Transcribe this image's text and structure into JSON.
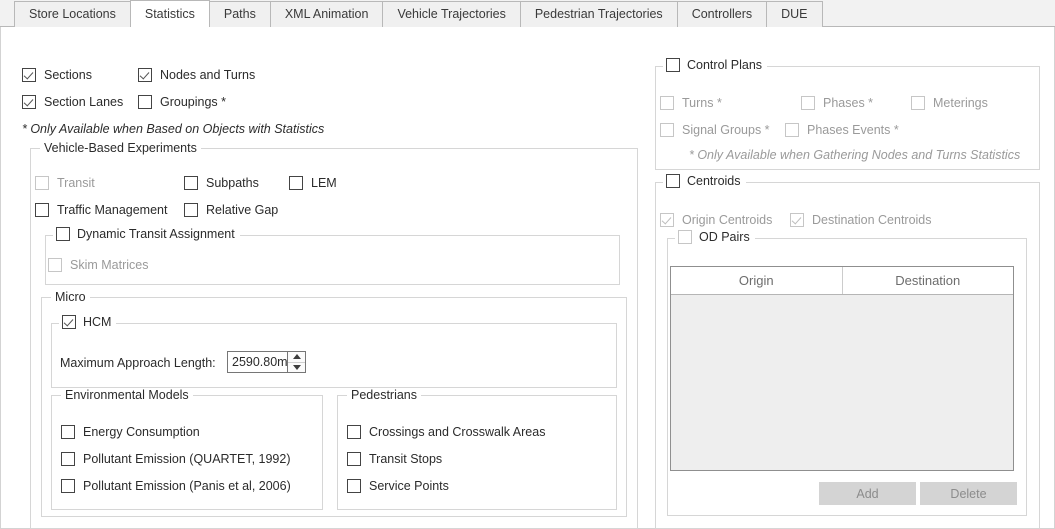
{
  "tabs": [
    {
      "label": "Store Locations",
      "active": false
    },
    {
      "label": "Statistics",
      "active": true
    },
    {
      "label": "Paths",
      "active": false
    },
    {
      "label": "XML Animation",
      "active": false
    },
    {
      "label": "Vehicle Trajectories",
      "active": false
    },
    {
      "label": "Pedestrian Trajectories",
      "active": false
    },
    {
      "label": "Controllers",
      "active": false
    },
    {
      "label": "DUE",
      "active": false
    }
  ],
  "left": {
    "top_checkboxes": {
      "sections": "Sections",
      "nodes_and_turns": "Nodes and Turns",
      "section_lanes": "Section Lanes",
      "groupings": "Groupings *"
    },
    "footnote": "* Only Available when Based on Objects with Statistics",
    "vehicle_based_experiments": {
      "legend": "Vehicle-Based Experiments",
      "transit": "Transit",
      "subpaths": "Subpaths",
      "lem": "LEM",
      "traffic_management": "Traffic Management",
      "relative_gap": "Relative Gap",
      "dynamic_transit_assignment": "Dynamic Transit Assignment",
      "skim_matrices": "Skim Matrices"
    },
    "micro": {
      "legend": "Micro",
      "hcm": "HCM",
      "max_approach_length_label": "Maximum Approach Length:",
      "max_approach_length_value": "2590.80m"
    },
    "environmental_models": {
      "legend": "Environmental Models",
      "items": [
        "Energy Consumption",
        "Pollutant Emission (QUARTET, 1992)",
        "Pollutant Emission (Panis et al, 2006)"
      ]
    },
    "pedestrians": {
      "legend": "Pedestrians",
      "items": [
        "Crossings and Crosswalk Areas",
        "Transit Stops",
        "Service Points"
      ]
    }
  },
  "right": {
    "control_plans": {
      "legend": "Control Plans",
      "turns": "Turns *",
      "phases": "Phases *",
      "meterings": "Meterings",
      "signal_groups": "Signal Groups *",
      "phases_events": "Phases Events *",
      "footnote": "* Only Available when Gathering Nodes and Turns Statistics"
    },
    "centroids": {
      "legend": "Centroids",
      "origin_centroids": "Origin Centroids",
      "destination_centroids": "Destination Centroids",
      "od_pairs_legend": "OD Pairs",
      "table": {
        "columns": [
          "Origin",
          "Destination"
        ],
        "rows": []
      },
      "add_button": "Add",
      "delete_button": "Delete"
    }
  }
}
